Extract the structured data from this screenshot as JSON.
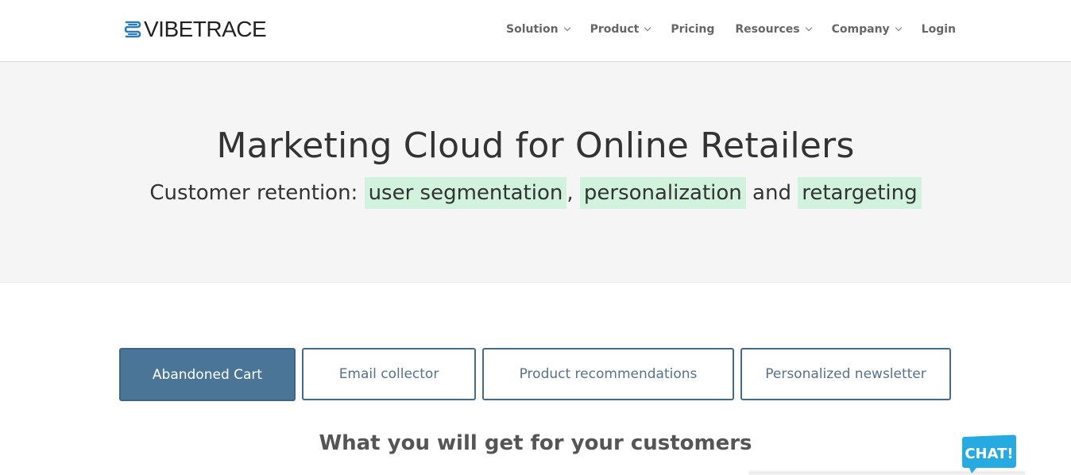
{
  "header": {
    "logo_text": "VIBETRACE",
    "nav": [
      {
        "label": "Solution",
        "has_dropdown": true
      },
      {
        "label": "Product",
        "has_dropdown": true
      },
      {
        "label": "Pricing",
        "has_dropdown": false
      },
      {
        "label": "Resources",
        "has_dropdown": true
      },
      {
        "label": "Company",
        "has_dropdown": true
      },
      {
        "label": "Login",
        "has_dropdown": false
      }
    ]
  },
  "hero": {
    "title": "Marketing Cloud for Online Retailers",
    "subtitle_prefix": "Customer retention:",
    "highlights": [
      "user segmentation",
      "personalization",
      "retargeting"
    ],
    "separator_comma": ",",
    "separator_and": "and",
    "highlight_color": "#d1f2dc"
  },
  "tabs": [
    {
      "label": "Abandoned Cart",
      "active": true
    },
    {
      "label": "Email collector",
      "active": false
    },
    {
      "label": "Product recommendations",
      "active": false
    },
    {
      "label": "Personalized newsletter",
      "active": false
    }
  ],
  "section": {
    "title": "What you will get for your customers"
  },
  "chat": {
    "label": "CHAT!",
    "color": "#27aae1"
  },
  "colors": {
    "accent": "#4a7597",
    "hero_bg": "#f5f5f5",
    "logo_icon": "#2b7bbf"
  }
}
